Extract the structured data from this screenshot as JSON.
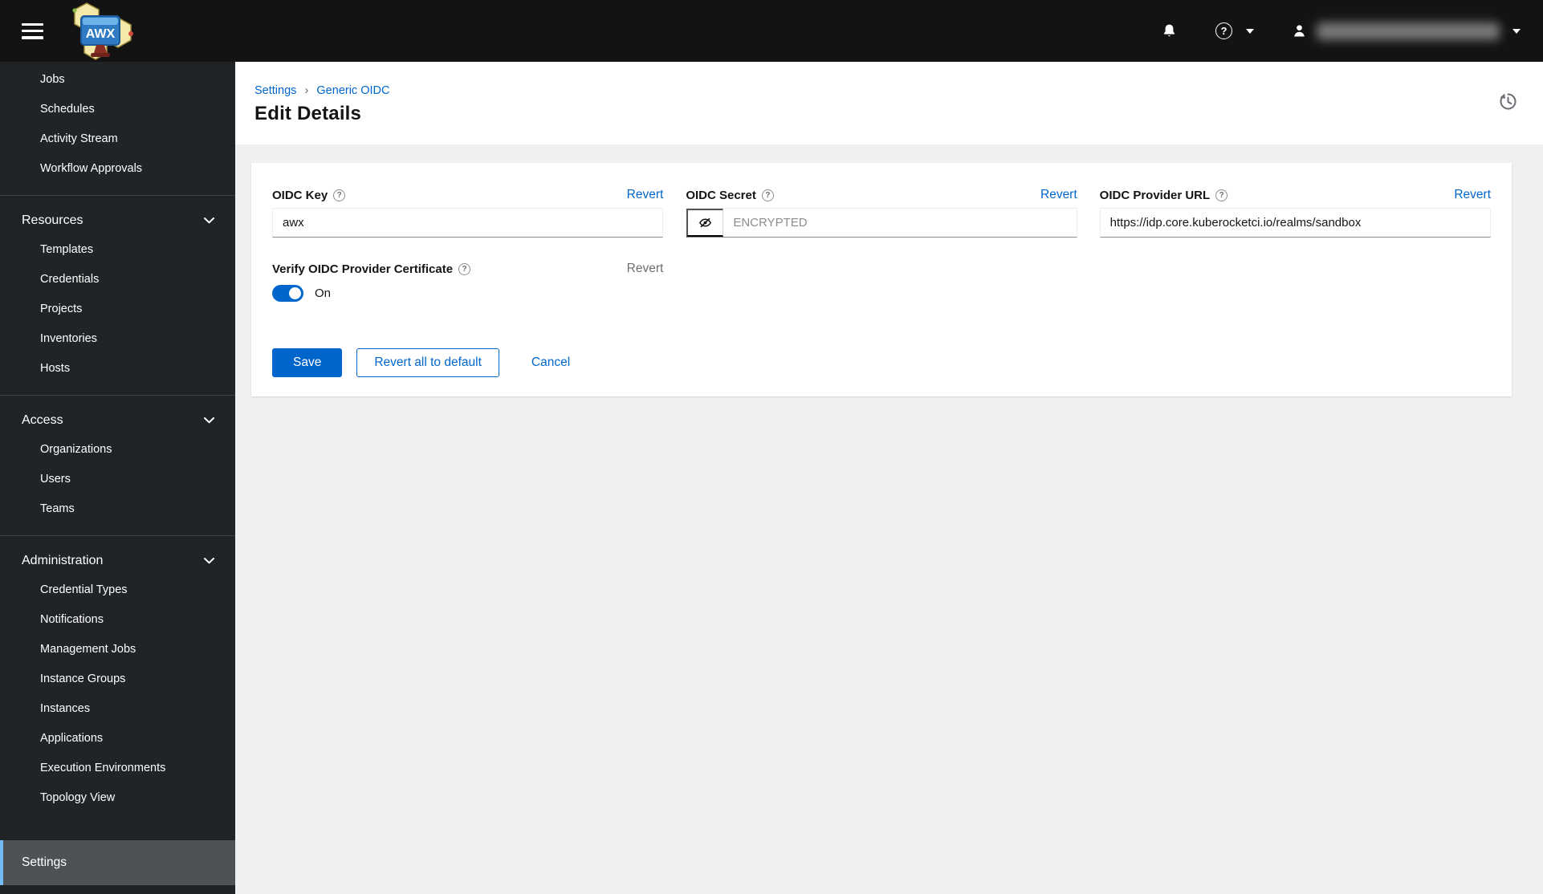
{
  "topbar": {
    "brand": "AWX",
    "icons": [
      "hamburger-menu-icon",
      "bell-icon",
      "question-circle-icon",
      "caret-down-icon",
      "user-icon"
    ]
  },
  "sidebar": {
    "groups": [
      {
        "items": [
          {
            "label": "Jobs"
          },
          {
            "label": "Schedules"
          },
          {
            "label": "Activity Stream"
          },
          {
            "label": "Workflow Approvals"
          }
        ]
      },
      {
        "header": "Resources",
        "items": [
          {
            "label": "Templates"
          },
          {
            "label": "Credentials"
          },
          {
            "label": "Projects"
          },
          {
            "label": "Inventories"
          },
          {
            "label": "Hosts"
          }
        ]
      },
      {
        "header": "Access",
        "items": [
          {
            "label": "Organizations"
          },
          {
            "label": "Users"
          },
          {
            "label": "Teams"
          }
        ]
      },
      {
        "header": "Administration",
        "items": [
          {
            "label": "Credential Types"
          },
          {
            "label": "Notifications"
          },
          {
            "label": "Management Jobs"
          },
          {
            "label": "Instance Groups"
          },
          {
            "label": "Instances"
          },
          {
            "label": "Applications"
          },
          {
            "label": "Execution Environments"
          },
          {
            "label": "Topology View"
          }
        ]
      },
      {
        "items": [
          {
            "label": "Settings",
            "selected": true
          }
        ]
      }
    ]
  },
  "breadcrumb": {
    "items": [
      {
        "label": "Settings"
      },
      {
        "label": "Generic OIDC"
      }
    ],
    "separator": "›"
  },
  "page": {
    "title": "Edit Details"
  },
  "form": {
    "fields": [
      {
        "label": "OIDC Key",
        "revert": "Revert",
        "value": "awx"
      },
      {
        "label": "OIDC Secret",
        "revert": "Revert",
        "placeholder": "ENCRYPTED"
      },
      {
        "label": "OIDC Provider URL",
        "revert": "Revert",
        "value": "https://idp.core.kuberocketci.io/realms/sandbox"
      }
    ],
    "certificate": {
      "label": "Verify OIDC Provider Certificate",
      "revert": "Revert",
      "state_label": "On",
      "enabled": true
    },
    "actions": {
      "save": "Save",
      "revert_all": "Revert all to default",
      "cancel": "Cancel"
    },
    "icons": [
      "question-circle-icon",
      "eye-slash-icon",
      "history-icon"
    ]
  },
  "colors": {
    "primary": "#0066cc",
    "topbar_bg": "#131313",
    "sidebar_bg": "#212427",
    "sidebar_selected_bg": "#4f5255",
    "sidebar_selected_accent": "#73bcf7",
    "content_bg": "#f0f0f0",
    "card_bg": "#ffffff",
    "muted_text": "#6a6e73",
    "input_bottom_border": "#8a8d90"
  }
}
